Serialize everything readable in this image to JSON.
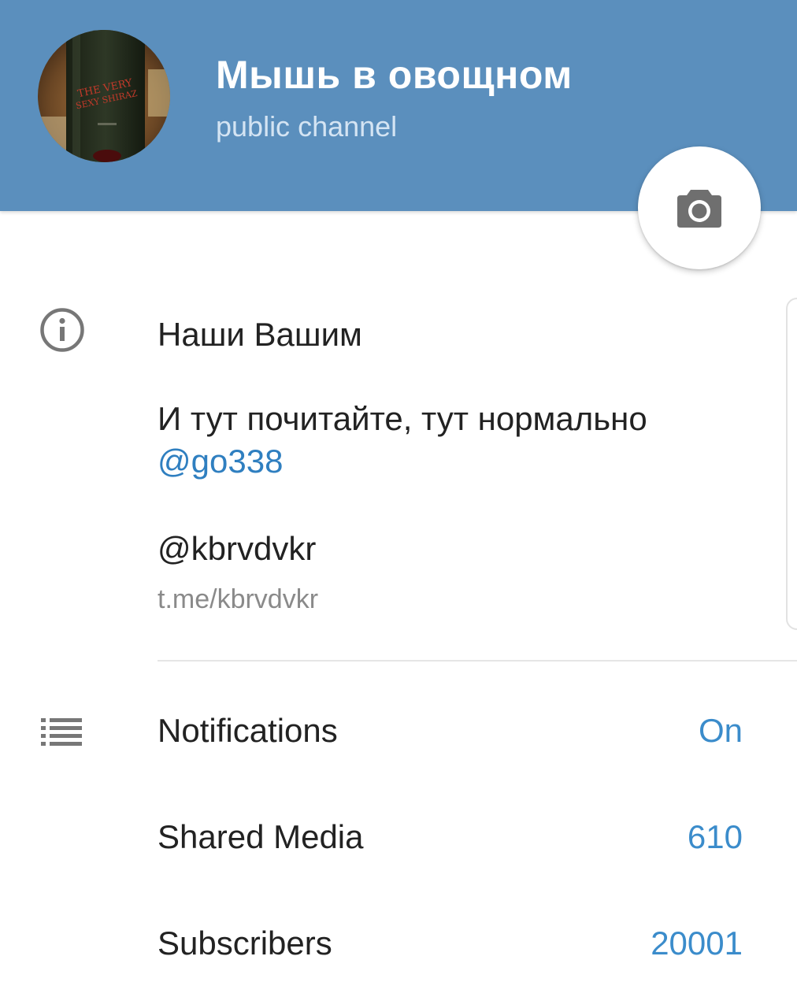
{
  "header": {
    "title": "Мышь в овощном",
    "subtitle": "public channel",
    "avatar_text_line1": "THE VERY",
    "avatar_text_line2": "SEXY SHIRAZ",
    "colors": {
      "header_bg": "#5b8fbd",
      "accent": "#3b8ccb"
    }
  },
  "camera_button": {
    "icon": "camera-icon"
  },
  "info": {
    "icon": "info-icon",
    "name": "Наши Вашим",
    "description": "И тут почитайте, тут нормально",
    "description_link": "@go338",
    "username": "@kbrvdvkr",
    "link": "t.me/kbrvdvkr"
  },
  "rows": [
    {
      "icon": "list-icon",
      "label": "Notifications",
      "value": "On"
    },
    {
      "label": "Shared Media",
      "value": "610"
    },
    {
      "label": "Subscribers",
      "value": "20001"
    }
  ]
}
